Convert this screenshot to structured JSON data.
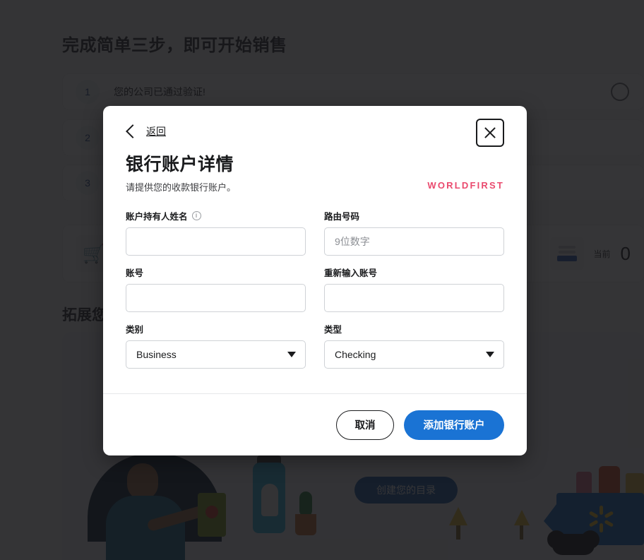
{
  "background": {
    "page_title": "完成简单三步，即可开始销售",
    "steps": [
      {
        "number": "1",
        "text": "您的公司已通过验证!"
      },
      {
        "number": "2",
        "text": ""
      },
      {
        "number": "3",
        "text": ""
      }
    ],
    "promo": {
      "icon": "shopping-cart-icon",
      "right_label": "当前",
      "right_value": "0"
    },
    "section_title": "拓展您",
    "hero": {
      "cta_label": "创建您的目录"
    }
  },
  "modal": {
    "back_label": "返回",
    "back_icon": "chevron-left-icon",
    "close_icon": "close-icon",
    "title": "银行账户详情",
    "subtitle": "请提供您的收款银行账户。",
    "brand": "WORLDFIRST",
    "brand_color": "#EA4A6E",
    "accent_color": "#1A73D4",
    "fields": {
      "account_holder": {
        "label": "账户持有人姓名",
        "info_icon": "info-icon",
        "value": "",
        "placeholder": ""
      },
      "routing_number": {
        "label": "路由号码",
        "value": "",
        "placeholder": "9位数字"
      },
      "account_number": {
        "label": "账号",
        "value": "",
        "placeholder": ""
      },
      "reenter_account_number": {
        "label": "重新输入账号",
        "value": "",
        "placeholder": ""
      },
      "category": {
        "label": "类别",
        "value": "Business",
        "caret_icon": "chevron-down-icon"
      },
      "type": {
        "label": "类型",
        "value": "Checking",
        "caret_icon": "chevron-down-icon"
      }
    },
    "footer": {
      "cancel_label": "取消",
      "submit_label": "添加银行账户"
    }
  }
}
